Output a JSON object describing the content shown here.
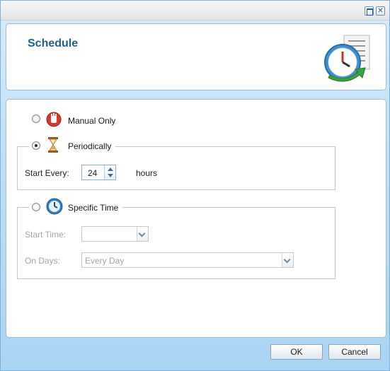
{
  "window": {
    "maximize_icon": "maximize-icon",
    "close_symbol": "✕"
  },
  "header": {
    "title": "Schedule",
    "icon": "schedule-clock-icon"
  },
  "options": {
    "manual": {
      "label": "Manual Only",
      "selected": false,
      "icon": "stop-hand-icon"
    },
    "periodic": {
      "label": "Periodically",
      "selected": true,
      "icon": "hourglass-icon",
      "start_every_label": "Start Every:",
      "start_every_value": "24",
      "unit_label": "hours"
    },
    "specific": {
      "label": "Specific Time",
      "selected": false,
      "icon": "clock-icon",
      "start_time_label": "Start Time:",
      "start_time_value": "",
      "on_days_label": "On Days:",
      "on_days_value": "Every Day"
    }
  },
  "footer": {
    "ok_label": "OK",
    "cancel_label": "Cancel"
  },
  "colors": {
    "title": "#1f5f96",
    "window_bg": "#bfe0f7",
    "disabled_text": "#a6a6a6"
  }
}
